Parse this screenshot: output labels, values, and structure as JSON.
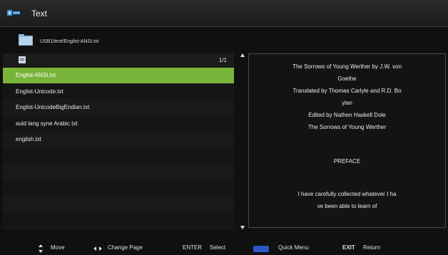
{
  "header": {
    "title": "Text",
    "icon": "text-app-icon"
  },
  "path": {
    "value": "USB1/text/Englist-ANSI.txt",
    "icon": "folder-icon"
  },
  "list": {
    "page": "1/1",
    "files": [
      "Englist-ANSI.txt",
      "Englist-Unicode.txt",
      "Englist-UnicodeBigEndian.txt",
      "auld lang syne Arabic.txt",
      "english.txt"
    ],
    "selected_index": 0
  },
  "preview": {
    "lines": [
      "The Sorrows of Young Werther by J.W. von",
      "Goethe",
      "Translated by Thomas Carlyle and R.D. Bo",
      "ylan",
      "Edited by Nathen Haskell Dole",
      "The Sorrows of Young Werther",
      "PREFACE",
      "I have carefully collected whatever I ha",
      "ve been able to learn of"
    ]
  },
  "footer": {
    "move": "Move",
    "change_page": "Change Page",
    "enter_key": "ENTER",
    "select": "Select",
    "quick_menu": "Quick Menu",
    "exit_key": "EXIT",
    "return": "Return"
  },
  "colors": {
    "selected": "#79b43a",
    "blue_key": "#2d57c8",
    "background": "#101010"
  }
}
